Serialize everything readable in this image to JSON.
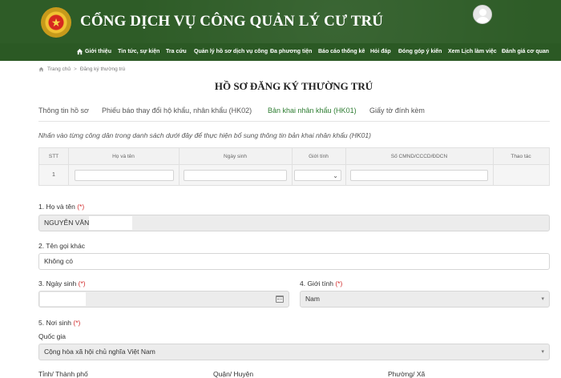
{
  "header": {
    "site_title": "CỔNG DỊCH VỤ CÔNG QUẢN LÝ CƯ TRÚ",
    "logo_icon": "police-emblem-icon",
    "avatar_icon": "user-avatar-icon",
    "brand_color": "#2e5c27"
  },
  "nav": {
    "items": [
      "Giới thiệu",
      "Tin tức, sự kiện",
      "Tra cứu",
      "Quản lý hồ sơ dịch vụ công",
      "Đa phương tiện",
      "Báo cáo thống kê",
      "Hỏi đáp",
      "Đóng góp ý kiến",
      "Xem Lịch làm việc",
      "Đánh giá cơ quan"
    ]
  },
  "breadcrumb": {
    "home": "Trang chủ",
    "separator": ">",
    "current": "Đăng ký thường trú"
  },
  "page_title": "HỒ SƠ ĐĂNG KÝ THƯỜNG TRÚ",
  "tabs": [
    {
      "label": "Thông tin hồ sơ",
      "active": false
    },
    {
      "label": "Phiếu báo thay đổi hộ khẩu, nhân khẩu (HK02)",
      "active": false
    },
    {
      "label": "Bản khai nhân khẩu (HK01)",
      "active": true
    },
    {
      "label": "Giấy tờ đính kèm",
      "active": false
    }
  ],
  "hint": "Nhấn vào từng công dân trong danh sách dưới đây để thực hiện bổ sung thông tin bản khai nhân khẩu (HK01)",
  "table": {
    "columns": [
      "STT",
      "Họ và tên",
      "Ngày sinh",
      "Giới tính",
      "Số CMND/CCCD/ĐDCN",
      "Thao tác"
    ],
    "rows": [
      {
        "stt": "1",
        "ho_ten": "",
        "ngay_sinh": "",
        "gioi_tinh": "",
        "so_giay_to": ""
      }
    ]
  },
  "form": {
    "ho_ten": {
      "label": "1. Họ và tên",
      "required": "(*)",
      "value": "NGUYỄN VĂN"
    },
    "ten_goi_khac": {
      "label": "2. Tên gọi khác",
      "value": "Không có"
    },
    "ngay_sinh": {
      "label": "3. Ngày sinh",
      "required": "(*)",
      "value": ""
    },
    "gioi_tinh": {
      "label": "4. Giới tính",
      "required": "(*)",
      "value": "Nam"
    },
    "noi_sinh": {
      "label": "5. Nơi sinh",
      "required": "(*)"
    },
    "quoc_gia": {
      "label": "Quốc gia",
      "value": "Cộng hòa xã hội chủ nghĩa Việt Nam"
    },
    "tinh_thanh_pho": {
      "label": "Tỉnh/ Thành phố"
    },
    "quan_huyen": {
      "label": "Quận/ Huyện"
    },
    "phuong_xa": {
      "label": "Phường/ Xã"
    }
  }
}
